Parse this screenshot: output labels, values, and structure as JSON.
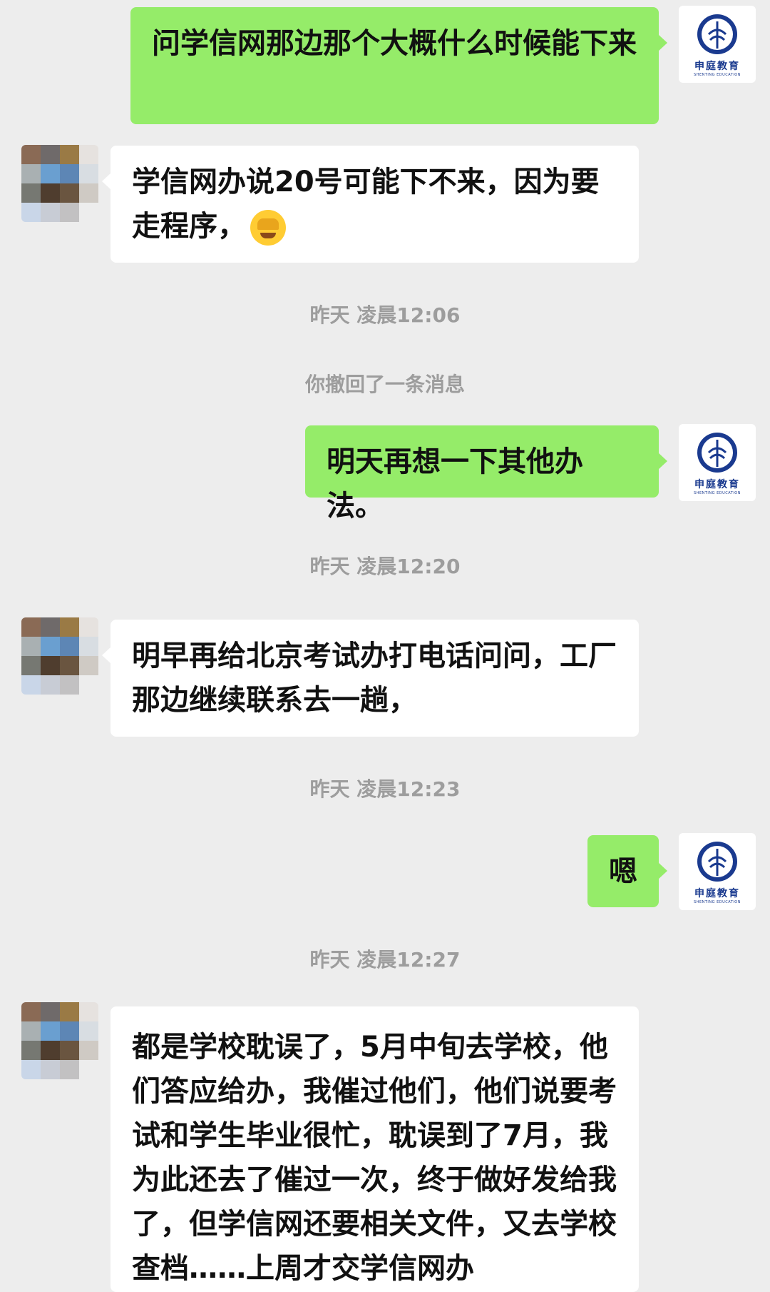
{
  "brand": {
    "logo_cn": "申庭教育",
    "logo_en": "SHENTING EDUCATION"
  },
  "messages": [
    {
      "from": "me",
      "text": "问学信网那边那个大概什么时候能下来"
    },
    {
      "from": "other",
      "text": "学信网办说20号可能下不来，因为要走程序，",
      "emoji": "face-palm-emoji"
    },
    {
      "type": "time",
      "text": "昨天 凌晨12:06"
    },
    {
      "type": "system",
      "text": "你撤回了一条消息"
    },
    {
      "from": "me",
      "text": "明天再想一下其他办法。"
    },
    {
      "type": "time",
      "text": "昨天 凌晨12:20"
    },
    {
      "from": "other",
      "text": "明早再给北京考试办打电话问问，工厂那边继续联系去一趟，"
    },
    {
      "type": "time",
      "text": "昨天 凌晨12:23"
    },
    {
      "from": "me",
      "text": "嗯"
    },
    {
      "type": "time",
      "text": "昨天 凌晨12:27"
    },
    {
      "from": "other",
      "text": "都是学校耽误了，5月中旬去学校，他们答应给办，我催过他们，他们说要考试和学生毕业很忙，耽误到了7月，我为此还去了催过一次，终于做好发给我了，但学信网还要相关文件，又去学校查档……上周才交学信网办"
    }
  ],
  "colors": {
    "background": "#ededed",
    "bubble_me": "#95ec69",
    "bubble_other": "#ffffff",
    "system_text": "#9d9d9d"
  }
}
